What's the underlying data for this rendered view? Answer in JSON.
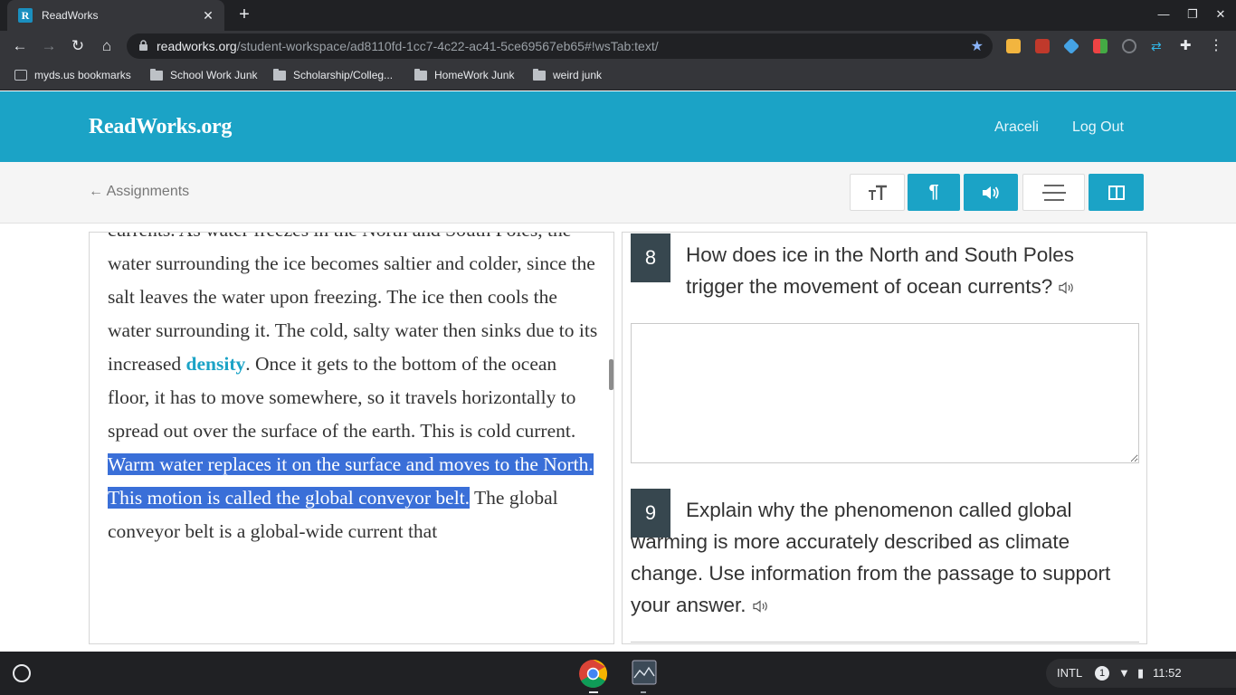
{
  "browser": {
    "tab_title": "ReadWorks",
    "favicon_letter": "R",
    "url_host": "readworks.org",
    "url_path": "/student-workspace/ad8110fd-1cc7-4c22-ac41-5ce69567eb65#!wsTab:text/",
    "bookmarks": [
      "myds.us bookmarks",
      "School Work Junk",
      "Scholarship/Colleg...",
      "HomeWork Junk",
      "weird junk"
    ]
  },
  "site": {
    "logo": "ReadWorks",
    "logo_suffix": ".org",
    "user_name": "Araceli",
    "logout_label": "Log Out",
    "back_label": "← Assignments"
  },
  "passage": {
    "line_1": "currents. As water freezes in the North and South Poles, the water surrounding the ice becomes saltier and colder, since the salt leaves the water upon freezing. The ice then cools the water surrounding it. The cold, salty water then sinks due to its increased ",
    "vocab_word": "density",
    "line_2": ". Once it gets to the bottom of the ocean floor, it has to move somewhere, so it travels horizontally to spread out over the surface of the earth. This is cold current. ",
    "highlighted": "Warm water replaces it on the surface and moves to the North. This motion is called the global conveyor belt.",
    "line_3": " The global conveyor belt is a global-wide current that"
  },
  "questions": [
    {
      "number": "8",
      "text": "How does ice in the North and South Poles trigger the movement of ocean currents?"
    },
    {
      "number": "9",
      "text": "Explain why the phenomenon called global warming is more accurately described as climate change. Use information from the passage to support your answer."
    }
  ],
  "system": {
    "ime": "INTL",
    "notification_count": "1",
    "time": "11:52"
  },
  "colors": {
    "brand": "#1ba3c6",
    "highlight": "#3a6fd8",
    "question_badge": "#37474f"
  }
}
